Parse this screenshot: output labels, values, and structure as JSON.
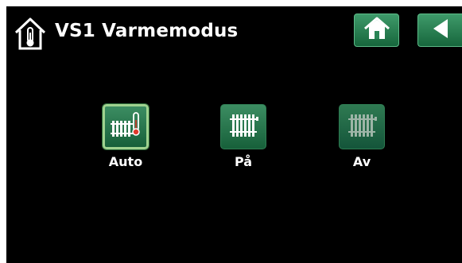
{
  "header": {
    "title": "VS1 Varmemodus",
    "icon": "house-thermometer-icon",
    "home_icon": "home-icon",
    "back_icon": "back-arrow-icon"
  },
  "modes": [
    {
      "label": "Auto",
      "icon": "radiator-thermometer-icon",
      "selected": true
    },
    {
      "label": "På",
      "icon": "radiator-icon",
      "selected": false
    },
    {
      "label": "Av",
      "icon": "radiator-off-icon",
      "selected": false
    }
  ],
  "colors": {
    "background": "#000000",
    "button_green": "#2f7f52",
    "selected_border": "#9fd28f",
    "text": "#ffffff"
  }
}
